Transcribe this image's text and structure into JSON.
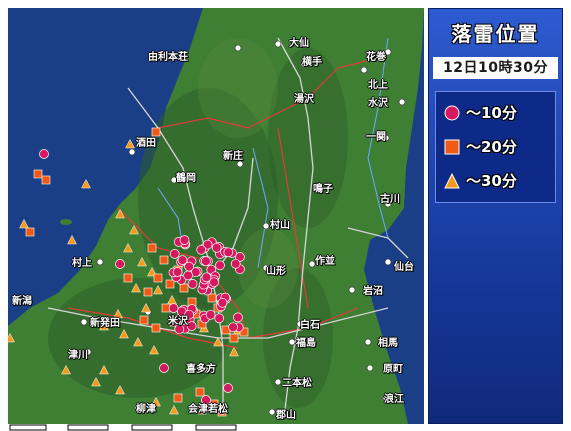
{
  "panel": {
    "title": "落雷位置",
    "timestamp": "12日10時30分",
    "legend": [
      {
        "label": "～10分",
        "shape": "circle",
        "color": "#d6195e"
      },
      {
        "label": "～20分",
        "shape": "square",
        "color": "#ef5a16"
      },
      {
        "label": "～30分",
        "shape": "triangle",
        "color": "#f19a1e"
      }
    ]
  },
  "cities": {
    "yurihonjo": "由利本荘",
    "daisen": "大仙",
    "hanamaki": "花巻",
    "yokote": "横手",
    "kitakami": "北上",
    "yuzawa": "湯沢",
    "mizusawa": "水沢",
    "sakata": "酒田",
    "ichinoseki": "一関",
    "shinjo": "新庄",
    "tsuruoka": "鶴岡",
    "naruko": "鳴子",
    "furukawa": "古川",
    "murayama": "村山",
    "murakami": "村上",
    "yamagata": "山形",
    "sakunami": "作並",
    "sendai": "仙台",
    "niigata": "新潟",
    "iwanuma": "岩沼",
    "shibata": "新発田",
    "yonezawa": "米沢",
    "shiroishi": "白石",
    "fukushima": "福島",
    "soma": "相馬",
    "tsugawa": "津川",
    "haramachi": "原町",
    "kitakata": "喜多方",
    "nihonmatsu": "二本松",
    "yanaizu": "柳津",
    "aizu": "会津若松",
    "namie": "浪江",
    "koriyama": "郡山"
  },
  "colors": {
    "sea": "#1b3f86",
    "land": "#3f7f34",
    "mountain": "#2c5e28",
    "strike_recent": "#d6195e",
    "strike_mid": "#ef5a16",
    "strike_old": "#f19a1e"
  }
}
